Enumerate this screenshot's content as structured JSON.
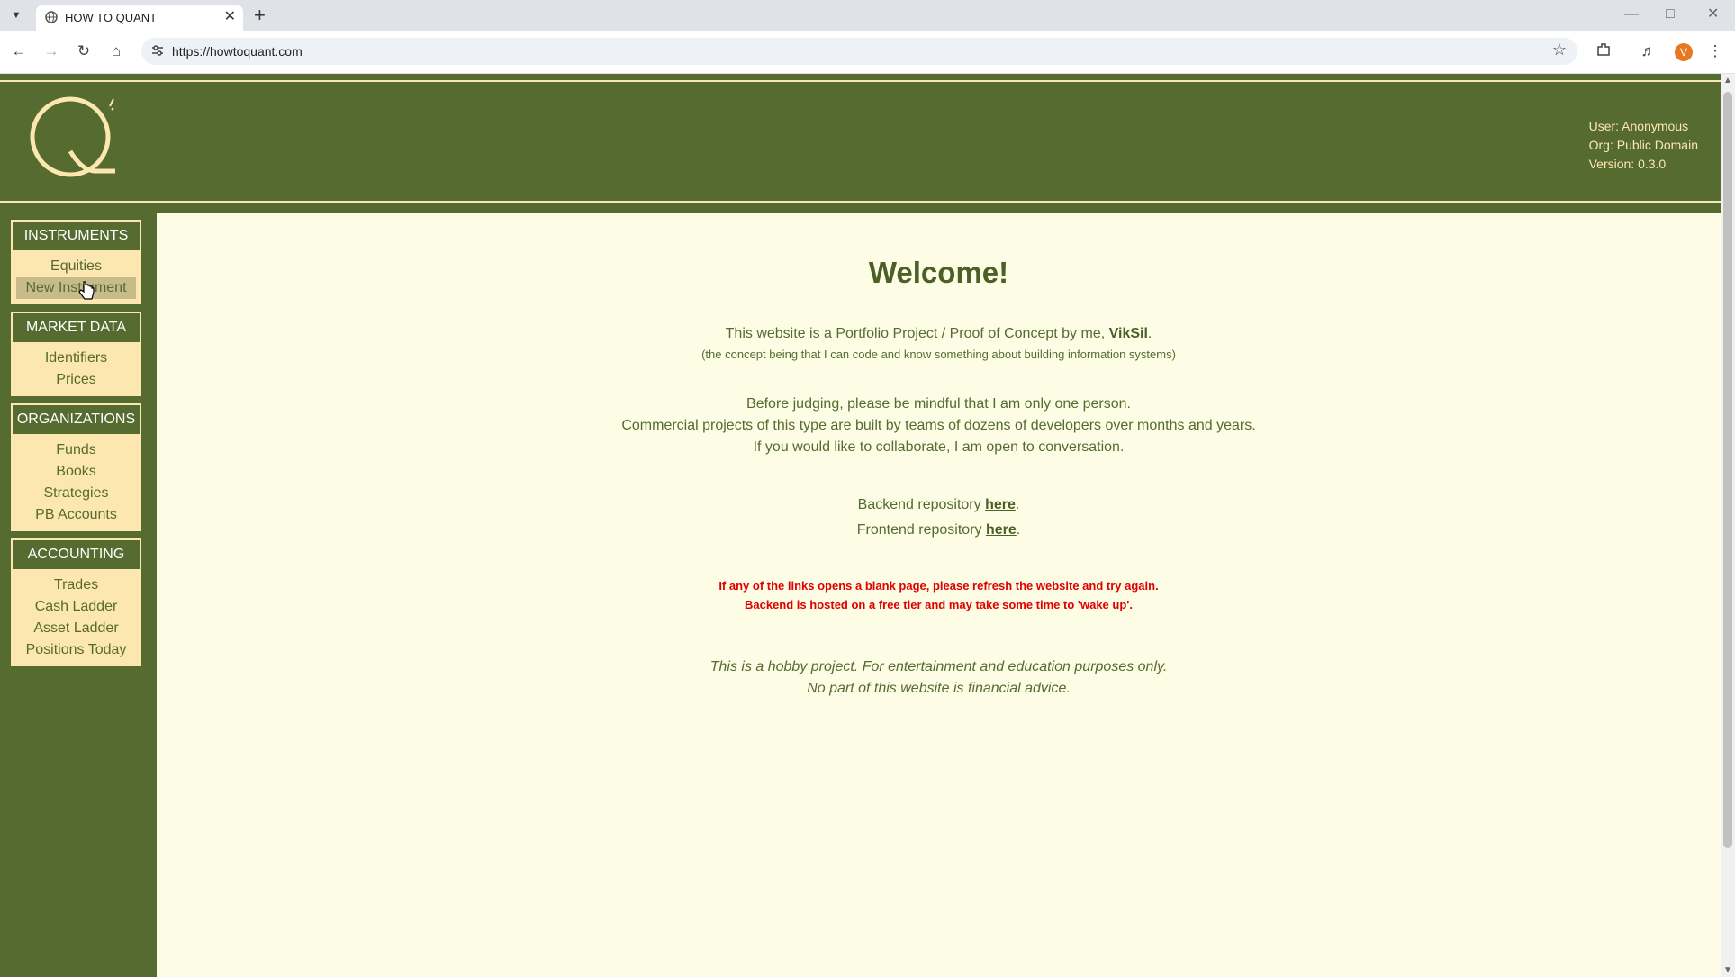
{
  "browser": {
    "tab_title": "HOW TO QUANT",
    "url": "https://howtoquant.com",
    "profile_initial": "V"
  },
  "header": {
    "user": "User: Anonymous",
    "org": "Org: Public Domain",
    "version": "Version: 0.3.0"
  },
  "sidebar": {
    "sections": [
      {
        "title": "INSTRUMENTS",
        "items": [
          "Equities",
          "New Instrument"
        ]
      },
      {
        "title": "MARKET DATA",
        "items": [
          "Identifiers",
          "Prices"
        ]
      },
      {
        "title": "ORGANIZATIONS",
        "items": [
          "Funds",
          "Books",
          "Strategies",
          "PB Accounts"
        ]
      },
      {
        "title": "ACCOUNTING",
        "items": [
          "Trades",
          "Cash Ladder",
          "Asset Ladder",
          "Positions Today"
        ]
      }
    ]
  },
  "main": {
    "title": "Welcome!",
    "intro_prefix": "This website is a Portfolio Project / Proof of Concept by me, ",
    "author_link": "VikSil",
    "intro_suffix": ".",
    "intro_note": "(the concept being that I can code and know something about building information systems)",
    "para1": "Before judging, please be mindful that I am only one person.",
    "para2": "Commercial projects of this type are built by teams of dozens of developers over months and years.",
    "para3": "If you would like to collaborate, I am open to conversation.",
    "backend_prefix": "Backend repository ",
    "frontend_prefix": "Frontend repository ",
    "here_link": "here",
    "period": ".",
    "warning1": "If any of the links opens a blank page, please refresh the website and try again.",
    "warning2": "Backend is hosted on a free tier and may take some time to 'wake up'.",
    "disclaimer1": "This is a hobby project. For entertainment and education purposes only.",
    "disclaimer2": "No part of this website is financial advice."
  }
}
